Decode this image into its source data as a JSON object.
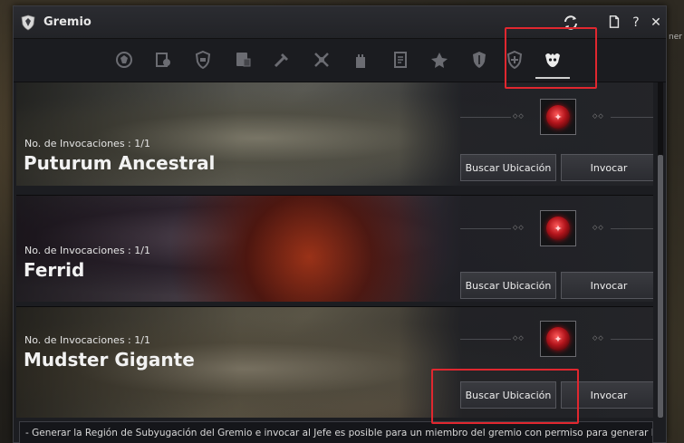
{
  "window": {
    "title": "Gremio",
    "icon": "guild-crest-icon",
    "buttons": [
      "refresh-icon",
      "document-icon",
      "help-icon",
      "close-icon"
    ],
    "help_label": "?",
    "close_label": "✕"
  },
  "background": {
    "partial_text": "ner"
  },
  "tabs": [
    {
      "icon": "guild-emblem-icon",
      "active": false
    },
    {
      "icon": "guild-members-icon",
      "active": false
    },
    {
      "icon": "guild-shield-icon",
      "active": false
    },
    {
      "icon": "guild-quest-icon",
      "active": false
    },
    {
      "icon": "guild-crafting-icon",
      "active": false
    },
    {
      "icon": "guild-battle-icon",
      "active": false
    },
    {
      "icon": "guild-castle-icon",
      "active": false
    },
    {
      "icon": "guild-notice-icon",
      "active": false
    },
    {
      "icon": "guild-war-icon",
      "active": false
    },
    {
      "icon": "guild-defense-icon",
      "active": false
    },
    {
      "icon": "guild-support-icon",
      "active": false
    },
    {
      "icon": "guild-boss-icon",
      "active": true
    }
  ],
  "bosses": [
    {
      "count_label": "No. de Invocaciones : 1/1",
      "name": "Puturum Ancestral",
      "locate_label": "Buscar Ubicación",
      "summon_label": "Invocar"
    },
    {
      "count_label": "No. de Invocaciones : 1/1",
      "name": "Ferrid",
      "locate_label": "Buscar Ubicación",
      "summon_label": "Invocar"
    },
    {
      "count_label": "No. de Invocaciones : 1/1",
      "name": "Mudster Gigante",
      "locate_label": "Buscar Ubicación",
      "summon_label": "Invocar"
    }
  ],
  "info_text": "- Generar la Región de Subyugación del Gremio e invocar al Jefe es posible para un miembro del gremio con permiso para generar la",
  "colors": {
    "highlight": "#e0272f",
    "window_bg": "#1c1d21",
    "button_bg": "#34353a"
  }
}
